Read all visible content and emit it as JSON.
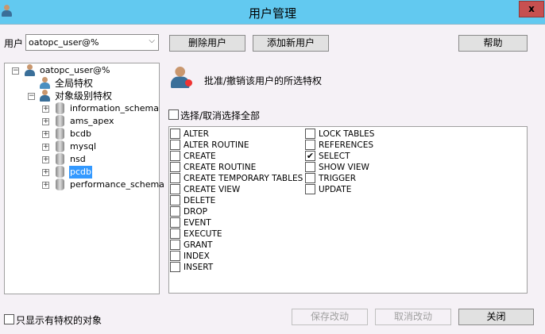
{
  "window": {
    "title": "用户管理",
    "close": "x"
  },
  "user": {
    "label": "用户",
    "value": "oatopc_user@%"
  },
  "buttons": {
    "delete_user": "删除用户",
    "add_user": "添加新用户",
    "help": "帮助",
    "save": "保存改动",
    "cancel": "取消改动",
    "close": "关闭"
  },
  "tree": {
    "root": "oatopc_user@%",
    "global": "全局特权",
    "object": "对象级别特权",
    "databases": [
      "information_schema",
      "ams_apex",
      "bcdb",
      "mysql",
      "nsd",
      "pcdb",
      "performance_schema"
    ],
    "selected": "pcdb"
  },
  "panel": {
    "heading": "批准/撤销该用户的所选特权",
    "select_all": "选择/取消选择全部"
  },
  "privileges_col1": [
    {
      "name": "ALTER",
      "checked": false
    },
    {
      "name": "ALTER ROUTINE",
      "checked": false
    },
    {
      "name": "CREATE",
      "checked": false
    },
    {
      "name": "CREATE ROUTINE",
      "checked": false
    },
    {
      "name": "CREATE TEMPORARY TABLES",
      "checked": false
    },
    {
      "name": "CREATE VIEW",
      "checked": false
    },
    {
      "name": "DELETE",
      "checked": false
    },
    {
      "name": "DROP",
      "checked": false
    },
    {
      "name": "EVENT",
      "checked": false
    },
    {
      "name": "EXECUTE",
      "checked": false
    },
    {
      "name": "GRANT",
      "checked": false
    },
    {
      "name": "INDEX",
      "checked": false
    },
    {
      "name": "INSERT",
      "checked": false
    }
  ],
  "privileges_col2": [
    {
      "name": "LOCK TABLES",
      "checked": false
    },
    {
      "name": "REFERENCES",
      "checked": false
    },
    {
      "name": "SELECT",
      "checked": true
    },
    {
      "name": "SHOW VIEW",
      "checked": false
    },
    {
      "name": "TRIGGER",
      "checked": false
    },
    {
      "name": "UPDATE",
      "checked": false
    }
  ],
  "footer": {
    "only_privileged": "只显示有特权的对象"
  }
}
